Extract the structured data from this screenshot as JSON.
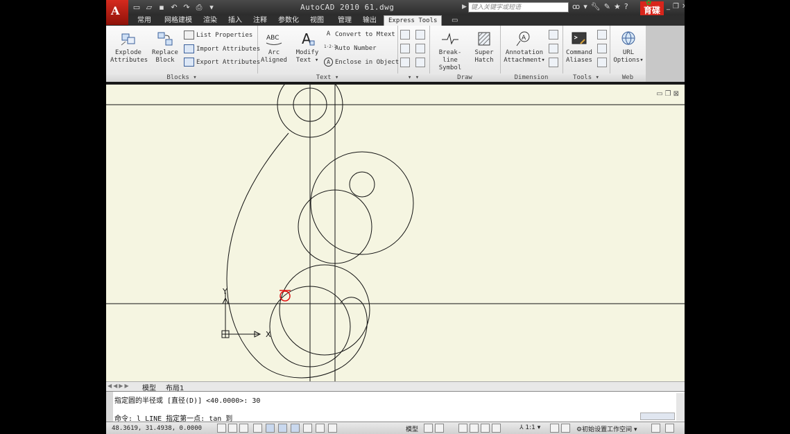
{
  "app": {
    "title": "AutoCAD 2010   61.dwg",
    "search_placeholder": "键入关键字或短语",
    "brand_text": "育碟教育"
  },
  "tabs": [
    "常用",
    "网格建模",
    "渲染",
    "插入",
    "注释",
    "参数化",
    "视图",
    "管理",
    "输出",
    "Express Tools"
  ],
  "ribbon": {
    "blocks": {
      "title": "Blocks",
      "explode_label": [
        "Explode",
        "Attributes"
      ],
      "replace_label": [
        "Replace",
        "Block"
      ],
      "list_properties": "List Properties",
      "import_attributes": "Import Attributes",
      "export_attributes": "Export Attributes"
    },
    "text": {
      "title": "Text",
      "arc_label": [
        "Arc",
        "Aligned"
      ],
      "modify_label": [
        "Modify",
        "Text"
      ],
      "convert_mtext": "Convert to Mtext",
      "auto_number": "Auto Number",
      "enclose_object": "Enclose in Object"
    },
    "draw": {
      "title": "Draw",
      "breakline_label": [
        "Break-line",
        "Symbol"
      ],
      "superhatch_label": [
        "Super",
        "Hatch"
      ]
    },
    "dimension": {
      "title": "Dimension",
      "annotation_label": [
        "Annotation",
        "Attachment"
      ]
    },
    "tools": {
      "title": "Tools",
      "command_label": [
        "Command",
        "Aliases"
      ]
    },
    "web": {
      "title": "Web",
      "url_label": [
        "URL",
        "Options"
      ]
    }
  },
  "layout_tabs": [
    "模型",
    "布局1"
  ],
  "command": {
    "line1": "指定圆的半径或 [直径(D)] <40.0000>: 30",
    "line2": "命令: l LINE 指定第一点: tan 到"
  },
  "status": {
    "coordinates": "48.3619,  31.4938, 0.0000",
    "model_label": "模型",
    "scale": "1:1",
    "workspace": "初始设置工作空间"
  },
  "colors": {
    "canvas": "#f5f5e1",
    "accent_red": "#d52a1e",
    "marker_red": "#e01010"
  }
}
